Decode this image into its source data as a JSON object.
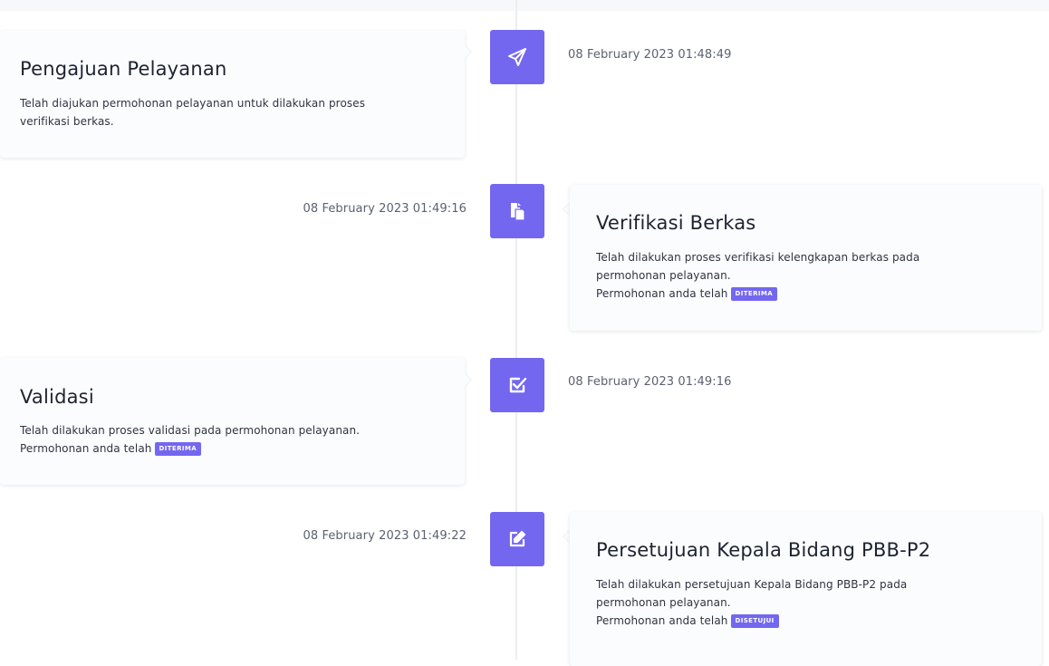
{
  "timeline": [
    {
      "title": "Pengajuan Pelayanan",
      "desc_line1": "Telah diajukan permohonan pelayanan untuk dilakukan proses",
      "desc_line2": "verifikasi berkas.",
      "date": "08 February 2023 01:48:49",
      "icon": "paper-plane-icon"
    },
    {
      "title": "Verifikasi Berkas",
      "desc_line1": "Telah dilakukan proses verifikasi kelengkapan berkas pada",
      "desc_line2": "permohonan pelayanan.",
      "status_prefix": "Permohonan anda telah",
      "status_badge": "DITERIMA",
      "date": "08 February 2023 01:49:16",
      "icon": "file-copy-icon"
    },
    {
      "title": "Validasi",
      "desc_line1": "Telah dilakukan proses validasi pada permohonan pelayanan.",
      "status_prefix": "Permohonan anda telah",
      "status_badge": "DITERIMA",
      "date": "08 February 2023 01:49:16",
      "icon": "check-square-icon"
    },
    {
      "title": "Persetujuan Kepala Bidang PBB-P2",
      "desc_line1": "Telah dilakukan persetujuan Kepala Bidang PBB-P2 pada",
      "desc_line2": "permohonan pelayanan.",
      "status_prefix": "Permohonan anda telah",
      "status_badge": "DISETUJUI",
      "date": "08 February 2023 01:49:22",
      "icon": "edit-icon"
    }
  ],
  "colors": {
    "accent": "#7367f0",
    "line": "#eceef2",
    "card": "#fbfcfe"
  }
}
